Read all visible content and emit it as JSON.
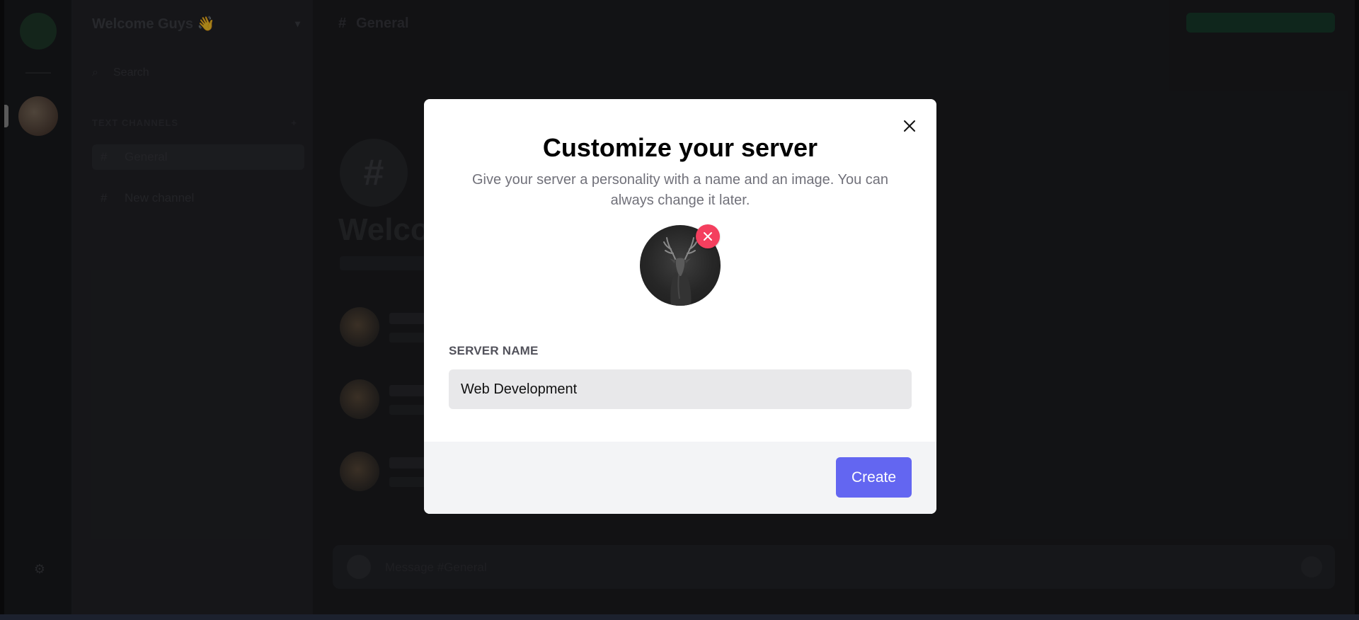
{
  "background": {
    "server_title": "Welcome Guys 👋",
    "search_label": "Search",
    "section_title": "TEXT CHANNELS",
    "channels": [
      {
        "label": "General"
      },
      {
        "label": "New channel"
      }
    ],
    "channel_header": "General",
    "hero_title": "Welcome",
    "composer_placeholder": "Message #General"
  },
  "modal": {
    "title": "Customize your server",
    "subtitle": "Give your server a personality with a name and an image. You can always change it later.",
    "server_name_label": "SERVER NAME",
    "server_name_value": "Web Development",
    "create_label": "Create",
    "icons": {
      "close": "close-icon",
      "remove_image": "x-icon",
      "server_image": "deer-image"
    }
  },
  "colors": {
    "primary_button": "#6366f1",
    "remove_badge": "#f43f5e",
    "input_bg": "#e8e8ea",
    "footer_bg": "#f3f4f6"
  }
}
